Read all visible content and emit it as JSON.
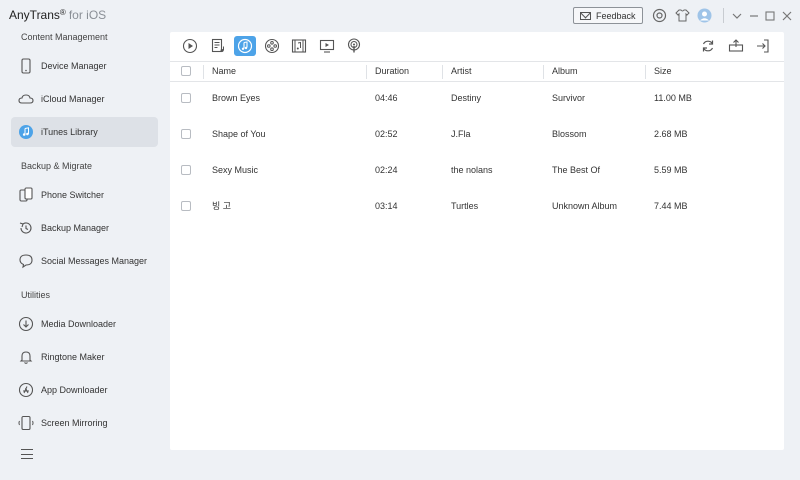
{
  "app": {
    "name": "AnyTrans",
    "reg": "®",
    "suffix": "for iOS",
    "feedback_label": "Feedback"
  },
  "sidebar": {
    "sections": [
      {
        "title": "Content Management"
      },
      {
        "title": "Backup & Migrate"
      },
      {
        "title": "Utilities"
      }
    ],
    "items": [
      {
        "label": "Device Manager",
        "icon": "phone-icon"
      },
      {
        "label": "iCloud Manager",
        "icon": "cloud-icon"
      },
      {
        "label": "iTunes Library",
        "icon": "itunes-icon",
        "active": true
      },
      {
        "label": "Phone Switcher",
        "icon": "phone-switch-icon"
      },
      {
        "label": "Backup Manager",
        "icon": "backup-icon"
      },
      {
        "label": "Social Messages Manager",
        "icon": "chat-icon"
      },
      {
        "label": "Media Downloader",
        "icon": "download-icon"
      },
      {
        "label": "Ringtone Maker",
        "icon": "bell-icon"
      },
      {
        "label": "App Downloader",
        "icon": "app-store-icon"
      },
      {
        "label": "Screen Mirroring",
        "icon": "mirror-icon"
      }
    ]
  },
  "toolbar": {
    "categories": [
      {
        "icon": "play-icon"
      },
      {
        "icon": "playlist-icon"
      },
      {
        "icon": "music-icon",
        "active": true
      },
      {
        "icon": "film-reel-icon"
      },
      {
        "icon": "music-video-icon"
      },
      {
        "icon": "tv-icon"
      },
      {
        "icon": "podcast-icon"
      }
    ],
    "actions": [
      {
        "icon": "refresh-icon"
      },
      {
        "icon": "export-to-device-icon"
      },
      {
        "icon": "import-icon"
      }
    ]
  },
  "table": {
    "columns": [
      "Name",
      "Duration",
      "Artist",
      "Album",
      "Size"
    ],
    "rows": [
      {
        "name": "Brown Eyes",
        "duration": "04:46",
        "artist": "Destiny",
        "album": "Survivor",
        "size": "11.00 MB"
      },
      {
        "name": "Shape of You",
        "duration": "02:52",
        "artist": "J.Fla",
        "album": "Blossom",
        "size": "2.68 MB"
      },
      {
        "name": "Sexy Music",
        "duration": "02:24",
        "artist": "the nolans",
        "album": "The Best Of",
        "size": "5.59 MB"
      },
      {
        "name": "빙 고",
        "duration": "03:14",
        "artist": "Turtles",
        "album": "Unknown Album",
        "size": "7.44 MB"
      }
    ]
  },
  "colors": {
    "accent": "#4da3e8",
    "background": "#eef1f5",
    "active_item": "#dde1e7"
  }
}
